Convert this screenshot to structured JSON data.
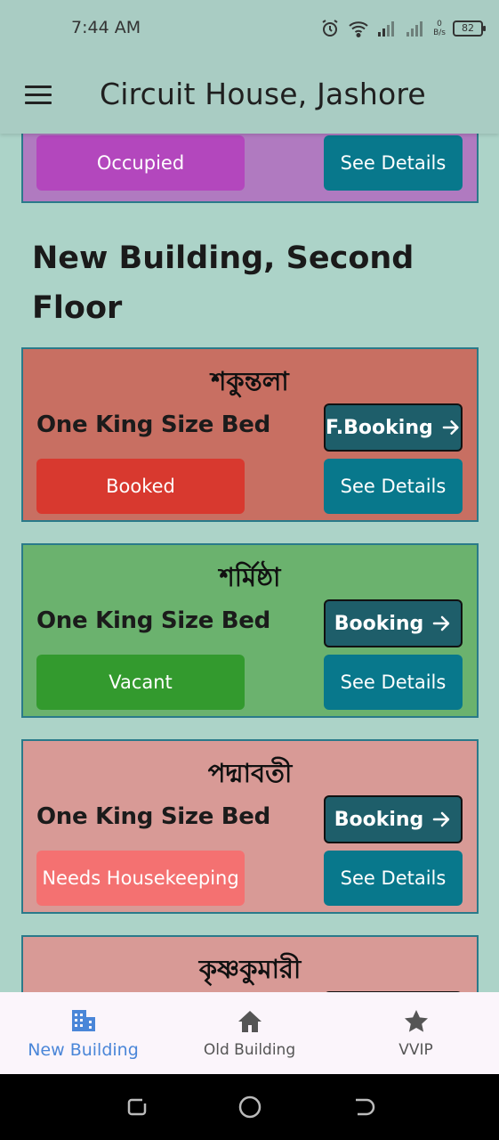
{
  "status_bar": {
    "time": "7:44 AM",
    "net_speed_value": "0",
    "net_speed_unit": "B/s",
    "battery": "82"
  },
  "app_bar": {
    "title": "Circuit House, Jashore"
  },
  "section": {
    "title": "New Building, Second Floor"
  },
  "cards": [
    {
      "status": "Occupied",
      "details_label": "See Details"
    },
    {
      "name": "শকুন্তলা",
      "bed": "One King Size Bed",
      "booking_label": "F.Booking",
      "status": "Booked",
      "details_label": "See Details"
    },
    {
      "name": "শর্মিষ্ঠা",
      "bed": "One King Size Bed",
      "booking_label": "Booking",
      "status": "Vacant",
      "details_label": "See Details"
    },
    {
      "name": "পদ্মাবতী",
      "bed": "One King Size Bed",
      "booking_label": "Booking",
      "status": "Needs Housekeeping",
      "details_label": "See Details"
    },
    {
      "name": "কৃষ্ণকুমারী"
    }
  ],
  "bottom_nav": {
    "items": [
      {
        "label": "New Building",
        "icon": "building-icon",
        "active": true
      },
      {
        "label": "Old Building",
        "icon": "home-icon",
        "active": false
      },
      {
        "label": "VVIP",
        "icon": "star-icon",
        "active": false
      }
    ]
  },
  "colors": {
    "background": "#acd3c8",
    "occupied": "#b347bd",
    "booked": "#d8392f",
    "vacant": "#339a2e",
    "housekeeping": "#f47171",
    "details_button": "#08788c",
    "nav_active": "#4a86d8"
  }
}
